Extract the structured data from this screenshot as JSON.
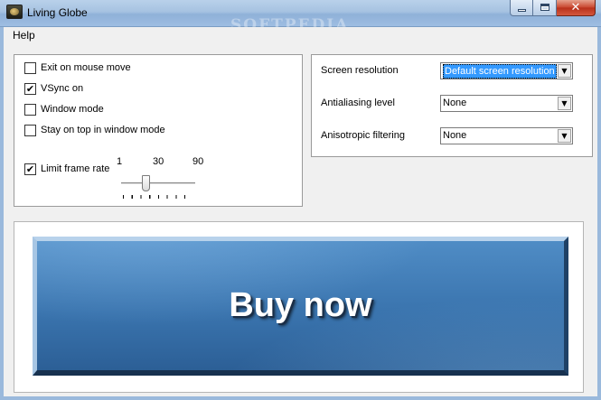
{
  "window": {
    "title": "Living Globe",
    "watermark": "SOFTPEDIA"
  },
  "menu": {
    "help": "Help"
  },
  "options": {
    "checkboxes": [
      {
        "label": "Exit on mouse move",
        "checked": false
      },
      {
        "label": "VSync on",
        "checked": true
      },
      {
        "label": "Window mode",
        "checked": false
      },
      {
        "label": "Stay on top in window mode",
        "checked": false
      },
      {
        "label": "Limit frame rate",
        "checked": true
      }
    ],
    "frame_rate_slider": {
      "min_label": "1",
      "mid_label": "30",
      "max_label": "90",
      "value": 30
    }
  },
  "settings": {
    "screen_resolution": {
      "label": "Screen resolution",
      "value": "Default screen resolution"
    },
    "antialiasing": {
      "label": "Antialiasing level",
      "value": "None"
    },
    "anisotropic": {
      "label": "Anisotropic filtering",
      "value": "None"
    }
  },
  "buy": {
    "label": "Buy now"
  },
  "glyphs": {
    "check": "✔",
    "dropdown": "▼",
    "close": "✕"
  }
}
